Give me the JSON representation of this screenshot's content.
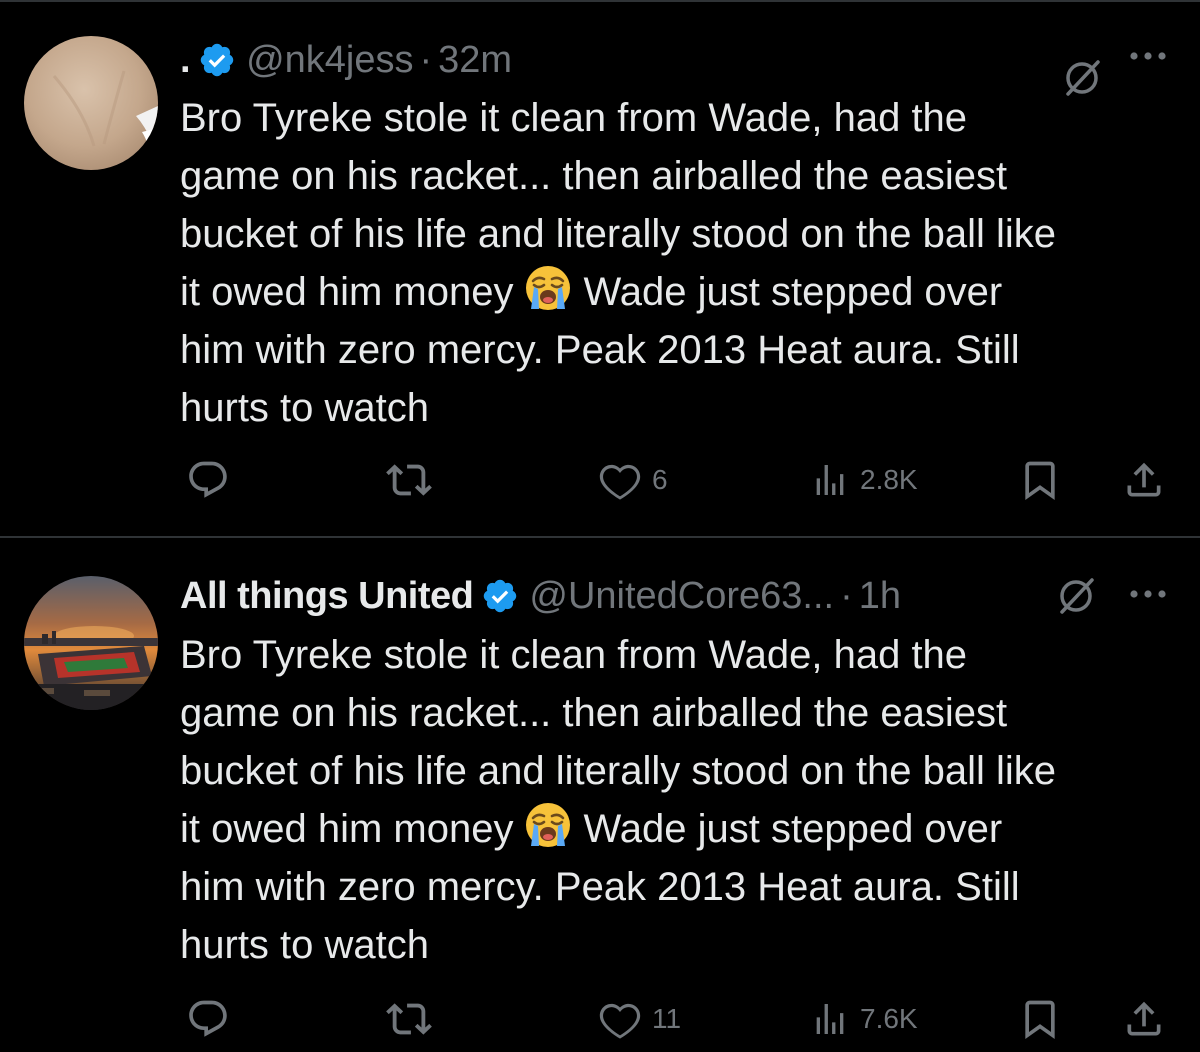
{
  "tweets": [
    {
      "display_name": ".",
      "verified": true,
      "handle": "@nk4jess",
      "separator": "·",
      "time": "32m",
      "text_lines": [
        "Bro Tyreke stole it clean from Wade, had the",
        "game on his racket... then airballed the easiest",
        "bucket of his life and literally stood on the ball like",
        "it owed him money",
        "him with zero mercy. Peak 2013 Heat aura. Still",
        "hurts to watch"
      ],
      "line4_after_emoji": "Wade just stepped over",
      "emoji": "loudly-crying-face",
      "actions": {
        "reply": "",
        "retweet": "",
        "like": "6",
        "views": "2.8K"
      },
      "icons": [
        "verified-badge-icon",
        "grok-icon",
        "more-icon",
        "reply-icon",
        "retweet-icon",
        "like-icon",
        "views-icon",
        "bookmark-icon",
        "share-icon"
      ]
    },
    {
      "display_name": "All things United",
      "verified": true,
      "handle": "@UnitedCore63...",
      "separator": "·",
      "time": "1h",
      "text_lines": [
        "Bro Tyreke stole it clean from Wade, had the",
        "game on his racket... then airballed the easiest",
        "bucket of his life and literally stood on the ball like",
        "it owed him money",
        "him with zero mercy. Peak 2013 Heat aura. Still",
        "hurts to watch"
      ],
      "line4_after_emoji": "Wade just stepped over",
      "emoji": "loudly-crying-face",
      "actions": {
        "reply": "",
        "retweet": "",
        "like": "11",
        "views": "7.6K"
      },
      "icons": [
        "verified-badge-icon",
        "grok-icon",
        "more-icon",
        "reply-icon",
        "retweet-icon",
        "like-icon",
        "views-icon",
        "bookmark-icon",
        "share-icon"
      ]
    }
  ],
  "colors": {
    "background": "#000000",
    "text_primary": "#e7e9ea",
    "text_secondary": "#71767b",
    "verified_blue": "#1d9bf0",
    "divider": "#2f3336"
  }
}
